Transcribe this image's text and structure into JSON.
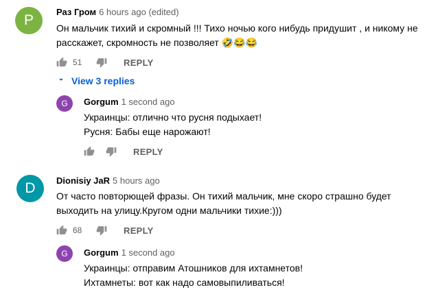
{
  "comments": [
    {
      "avatar_letter": "P",
      "avatar_color": "#7cb342",
      "author": "Раз Гром",
      "time": "6 hours ago (edited)",
      "lines": [
        "Он мальчик тихий и скромный !!! Тихо ночью кого нибудь придушит , и никому не",
        "расскажет, скромность не позволяет 🤣😂😂"
      ],
      "likes": "51",
      "reply_label": "REPLY",
      "view_replies_label": "View 3 replies",
      "reply": {
        "avatar_letter": "G",
        "avatar_color": "#8e44ad",
        "author": "Gorgum",
        "time": "1 second ago",
        "lines": [
          "Украинцы: отлично что русня подыхает!",
          "Русня: Бабы еще нарожают!"
        ],
        "reply_label": "REPLY"
      }
    },
    {
      "avatar_letter": "D",
      "avatar_color": "#0097a7",
      "author": "Dionisiy JaR",
      "time": "5 hours ago",
      "lines": [
        "От часто повторющей фразы. Он тихий мальчик, мне скоро страшно будет",
        "выходить на улицу.Кругом одни мальчики тихие:)))"
      ],
      "likes": "68",
      "reply_label": "REPLY",
      "reply": {
        "avatar_letter": "G",
        "avatar_color": "#8e44ad",
        "author": "Gorgum",
        "time": "1 second ago",
        "lines": [
          "Украинцы: отправим Атошников для ихтамнетов!",
          "Ихтамнеты: вот как надо самовыпиливаться!"
        ]
      }
    }
  ],
  "colors": {
    "link": "#065fd4",
    "secondary_text": "#606060"
  },
  "icons": [
    "thumb-up-icon",
    "thumb-down-icon",
    "chevron-down-icon"
  ]
}
